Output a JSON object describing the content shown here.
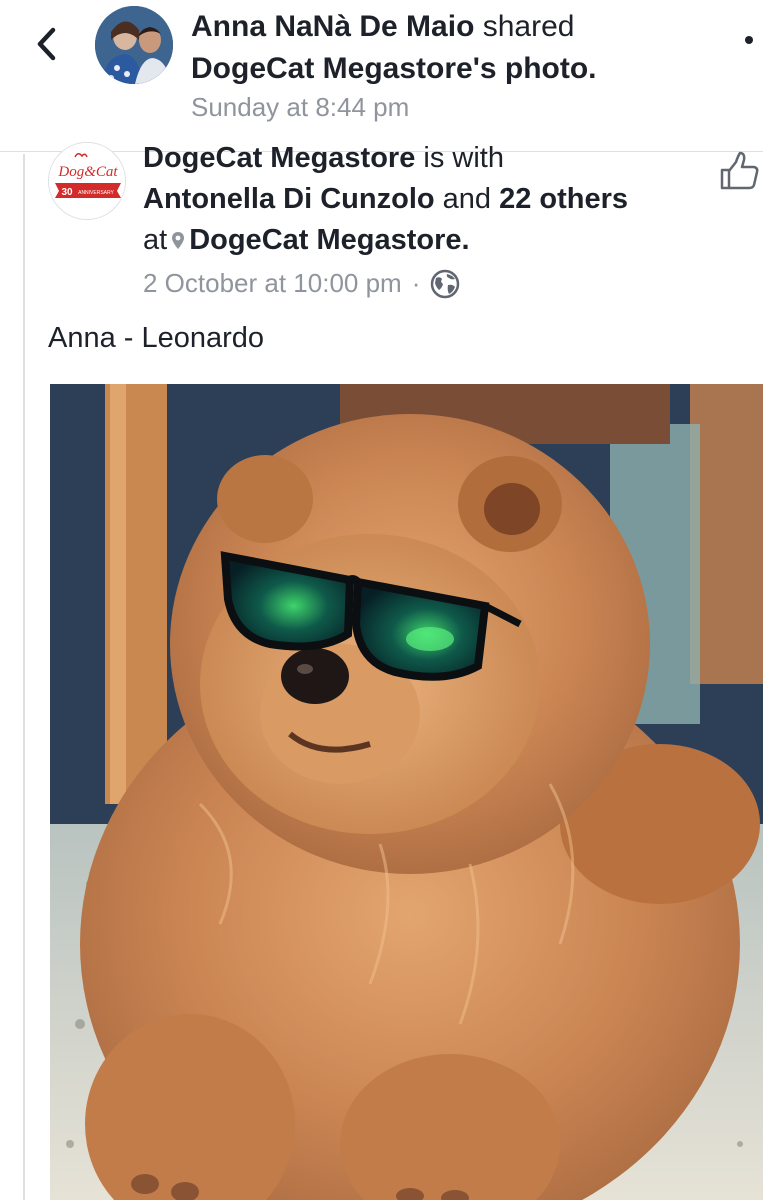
{
  "header": {
    "actor": "Anna NaNà De Maio",
    "verb": " shared",
    "owner": "DogeCat Megastore",
    "possessive": "'s",
    "object": " photo.",
    "time": "Sunday at 8:44 pm"
  },
  "post": {
    "page_name": "DogeCat Megastore",
    "with_word": " is with",
    "tagged_first": "Antonella Di Cunzolo",
    "and_word": " and ",
    "tagged_more": "22 others",
    "at_word": "at",
    "location": "DogeCat Megastore",
    "location_end": ".",
    "time": "2 October at 10:00 pm",
    "separator": "·",
    "caption": "Anna - Leonardo"
  },
  "logo": {
    "line1": "Dog&Cat",
    "number": "30",
    "ribbon": "ANNIVERSARY"
  },
  "colors": {
    "link_text": "#1d2129",
    "meta_text": "#90949c",
    "divider": "#dddfe2",
    "logo_red": "#d32a2a"
  },
  "icons": {
    "back": "chevron-left-icon",
    "more": "more-dots-icon",
    "like": "thumbs-up-icon",
    "pin": "location-pin-icon",
    "audience": "globe-icon"
  }
}
